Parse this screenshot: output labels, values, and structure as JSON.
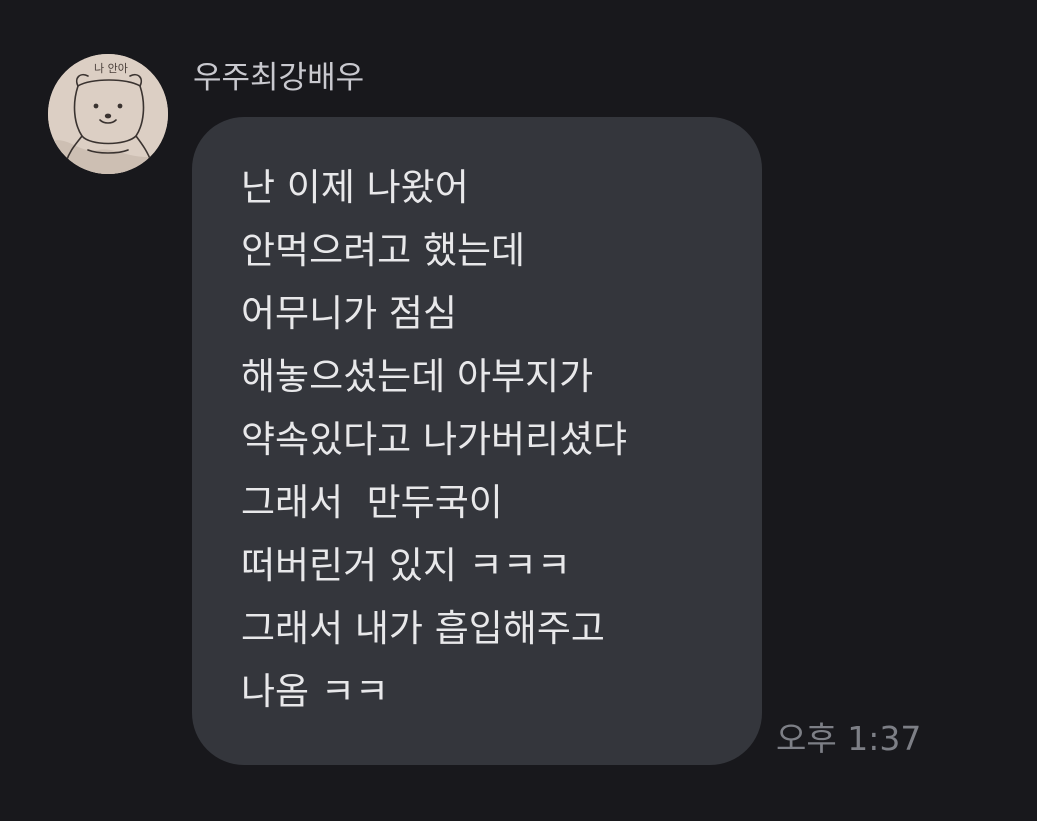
{
  "message": {
    "sender_name": "우주최강배우",
    "avatar_icon": "bear-drawing-avatar",
    "avatar_caption": "나 안아",
    "lines": [
      "난 이제 나왔어",
      "안먹으려고 했는데",
      "어무니가 점심",
      "해놓으셨는데 아부지가",
      "약속있다고 나가버리셨댜",
      "그래서  만두국이",
      "떠버린거 있지 ㅋㅋㅋ",
      "그래서 내가 흡입해주고",
      "나옴 ㅋㅋ"
    ],
    "time": "오후 1:37"
  },
  "colors": {
    "background": "#18181c",
    "bubble": "#34363c",
    "text": "#e8e8ea",
    "sender": "#c9c9cf",
    "time": "#7d7f86"
  }
}
